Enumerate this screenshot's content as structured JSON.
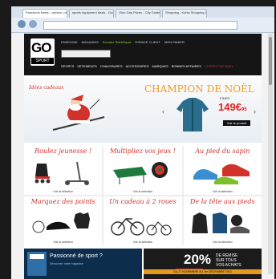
{
  "browser": {
    "tabs": [
      {
        "label": "Facebook News - opinion, pictures, ne..."
      },
      {
        "label": "sports equipment deals - Google Se..."
      },
      {
        "label": "Ohio Gas Prices - City Guide Informa..."
      },
      {
        "label": "Shopping - Kohls Shopping Guid..."
      }
    ]
  },
  "site": {
    "logo_top": "GO",
    "logo_bottom": "SPORT",
    "top_links": [
      "ENSEIGNE",
      "MAGASINS",
      "Ecoutez TeleMSport",
      "ESPACE CLIENT",
      "MON PANIER"
    ],
    "menu": [
      "SPORTS",
      "VETEMENTS",
      "CHAUSSURES",
      "ACCESSOIRES",
      "MARQUES",
      "BONNES AFFAIRES",
      "L'ESPRIT DE NOEL"
    ],
    "banner": {
      "ribbon": "Idées cadeaux",
      "title": "CHAMPION DE NOËL",
      "brand": "EIDER",
      "price": "149€",
      "price_cents": "95",
      "cta": "Voir le produit"
    },
    "tiles": [
      {
        "title": "Roulez jeunesse !",
        "link": "Voir la sélection"
      },
      {
        "title": "Multipliez vos jeux !",
        "link": "Voir la sélection"
      },
      {
        "title": "Au pied du sapin",
        "link": "Voir la sélection"
      },
      {
        "title": "Marquez des points",
        "link": "Voir la sélection"
      },
      {
        "title": "Un cadeau à 2 roues",
        "link": "Voir la sélection"
      },
      {
        "title": "De la tête aux pieds",
        "link": "Voir la sélection"
      }
    ],
    "footer_left": {
      "question": "Passionné de sport ?",
      "subtitle": "Découvrez notre magazine"
    },
    "footer_right": {
      "percent": "20%",
      "remise": [
        "DE REMISE",
        "SUR TOUS",
        "VOS ACHATS"
      ],
      "tag": "PROLONGATION",
      "dates": "DU 27 NOVEMBRE AU 1er DÉCEMBRE 2013"
    }
  }
}
